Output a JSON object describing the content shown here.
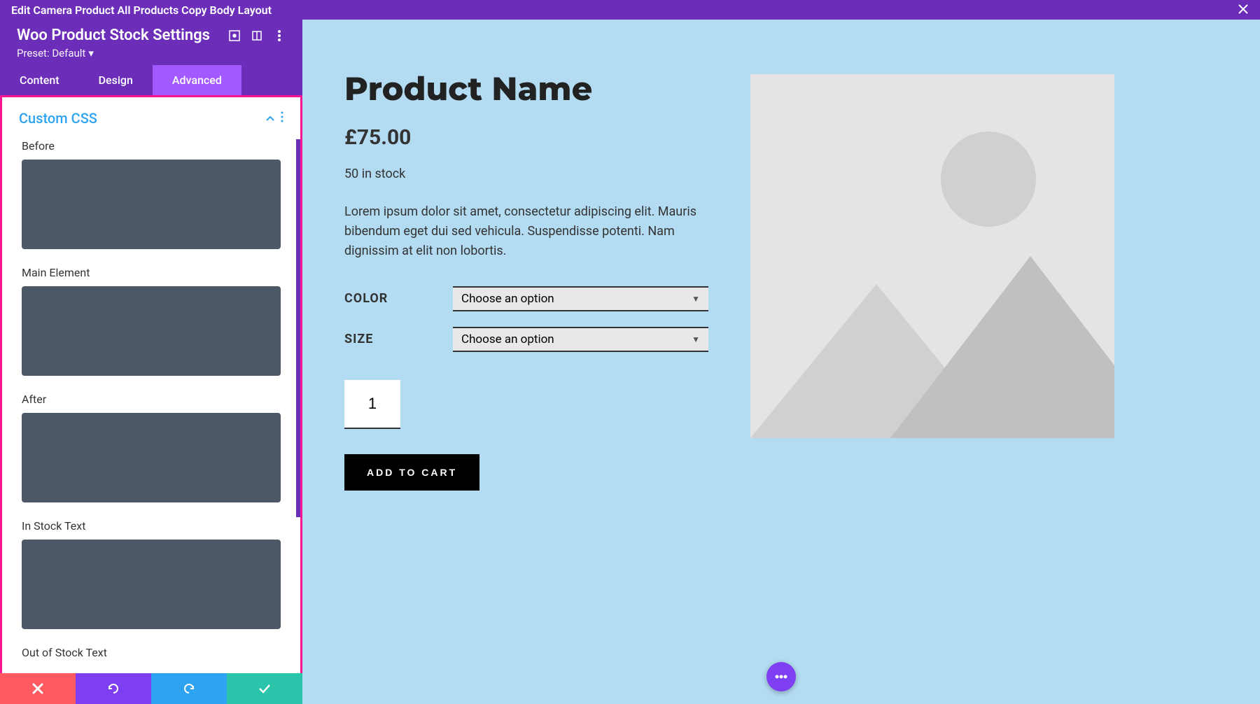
{
  "topBar": {
    "title": "Edit Camera Product All Products Copy Body Layout"
  },
  "sidebar": {
    "title": "Woo Product Stock Settings",
    "preset": "Preset: Default",
    "tabs": {
      "content": "Content",
      "design": "Design",
      "advanced": "Advanced"
    },
    "section": {
      "title": "Custom CSS",
      "fields": {
        "before": "Before",
        "mainElement": "Main Element",
        "after": "After",
        "inStockText": "In Stock Text",
        "outOfStockText": "Out of Stock Text"
      }
    }
  },
  "preview": {
    "productTitle": "Product Name",
    "price": "£75.00",
    "stock": "50 in stock",
    "description": "Lorem ipsum dolor sit amet, consectetur adipiscing elit. Mauris bibendum eget dui sed vehicula. Suspendisse potenti. Nam dignissim at elit non lobortis.",
    "variants": {
      "colorLabel": "COLOR",
      "sizeLabel": "SIZE",
      "placeholder": "Choose an option"
    },
    "quantity": "1",
    "addToCart": "ADD TO CART"
  }
}
